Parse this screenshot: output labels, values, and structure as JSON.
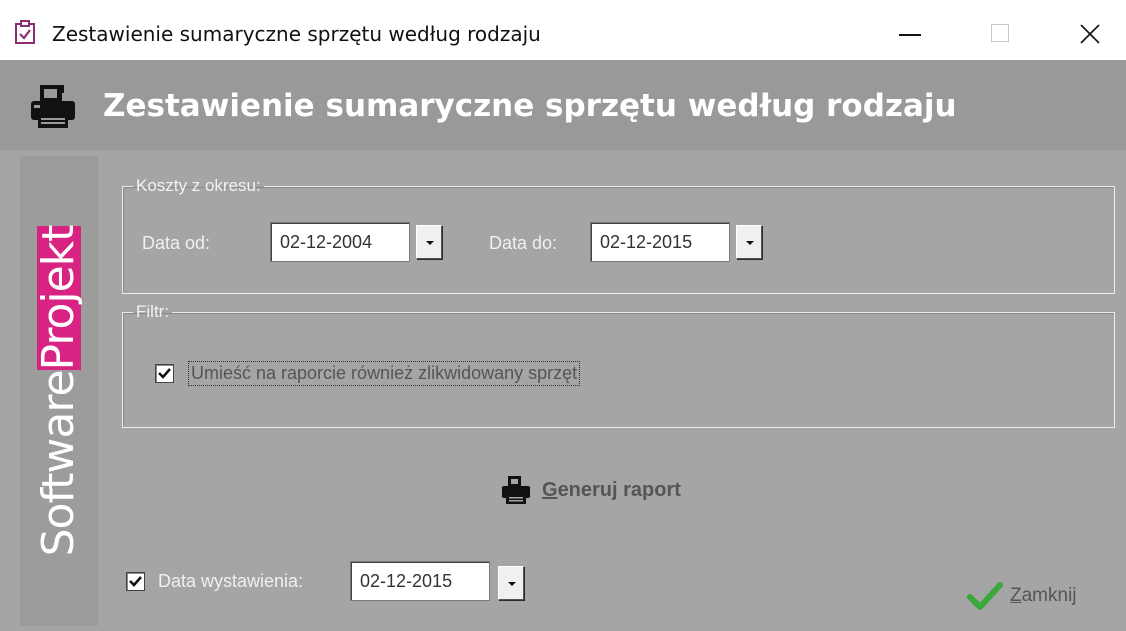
{
  "window": {
    "title": "Zestawienie sumaryczne sprzętu według rodzaju",
    "icons": {
      "app": "clipboard-check-icon",
      "minimize": "minimize-icon",
      "maximize": "maximize-icon",
      "close": "close-icon"
    }
  },
  "header": {
    "title": "Zestawienie sumaryczne sprzętu według rodzaju",
    "icon": "printer-icon"
  },
  "brand": {
    "part1": "Software",
    "part2": "Projekt",
    "accent_color": "#d92383"
  },
  "period_group": {
    "legend": "Koszty z okresu:",
    "date_from_label": "Data od:",
    "date_from_value": "02-12-2004",
    "date_to_label": "Data do:",
    "date_to_value": "02-12-2015"
  },
  "filter_group": {
    "legend": "Filtr:",
    "include_liquidated": {
      "label": "Umieść na raporcie również zlikwidowany sprzęt",
      "checked": true
    }
  },
  "actions": {
    "generate": {
      "mnemonic": "G",
      "rest": "eneruj raport",
      "icon": "printer-icon"
    },
    "close": {
      "mnemonic": "Z",
      "rest": "amknij",
      "icon": "checkmark-icon",
      "icon_color": "#3aa83a"
    }
  },
  "issue_date": {
    "label": "Data wystawienia:",
    "value": "02-12-2015",
    "checked": true
  }
}
